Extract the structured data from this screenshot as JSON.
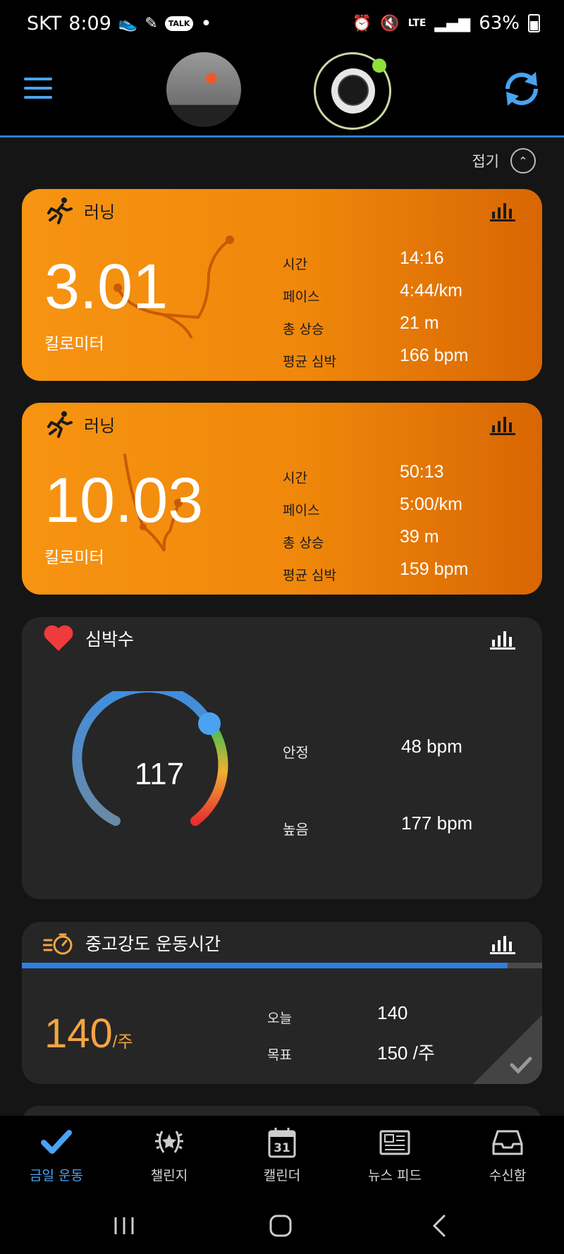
{
  "status_bar": {
    "carrier": "SKT",
    "time": "8:09",
    "talk": "TALK",
    "dot": "•",
    "network": "LTE",
    "battery": "63%"
  },
  "header": {
    "menu_icon": "hamburger-menu-icon",
    "sync_icon": "sync-icon"
  },
  "collapse": {
    "label": "접기"
  },
  "activities": [
    {
      "title": "러닝",
      "distance": "3.01",
      "unit": "킬로미터",
      "stats": [
        {
          "label": "시간",
          "value": "14:16"
        },
        {
          "label": "페이스",
          "value": "4:44/km"
        },
        {
          "label": "총 상승",
          "value": "21 m"
        },
        {
          "label": "평균 심박",
          "value": "166 bpm"
        }
      ]
    },
    {
      "title": "러닝",
      "distance": "10.03",
      "unit": "킬로미터",
      "stats": [
        {
          "label": "시간",
          "value": "50:13"
        },
        {
          "label": "페이스",
          "value": "5:00/km"
        },
        {
          "label": "총 상승",
          "value": "39 m"
        },
        {
          "label": "평균 심박",
          "value": "159 bpm"
        }
      ]
    }
  ],
  "heart_rate": {
    "title": "심박수",
    "current": "117",
    "resting_label": "안정",
    "resting_value": "48 bpm",
    "high_label": "높음",
    "high_value": "177 bpm"
  },
  "intensity": {
    "title": "중고강도 운동시간",
    "value": "140",
    "per": "/주",
    "today_label": "오늘",
    "today_value": "140",
    "goal_label": "목표",
    "goal_value": "150 /주",
    "progress": 0.934
  },
  "bottom_nav": [
    {
      "label": "금일 운동",
      "icon": "checkmark-icon",
      "active": true
    },
    {
      "label": "챌린지",
      "icon": "laurel-icon",
      "active": false
    },
    {
      "label": "캘린더",
      "icon": "calendar-icon",
      "active": false,
      "day": "31"
    },
    {
      "label": "뉴스 피드",
      "icon": "newspaper-icon",
      "active": false
    },
    {
      "label": "수신함",
      "icon": "inbox-icon",
      "active": false
    }
  ],
  "colors": {
    "accent": "#4aa3f0",
    "run_orange": "#f79411",
    "intensity_orange": "#f3a443",
    "progress_blue": "#2f7ee0"
  }
}
